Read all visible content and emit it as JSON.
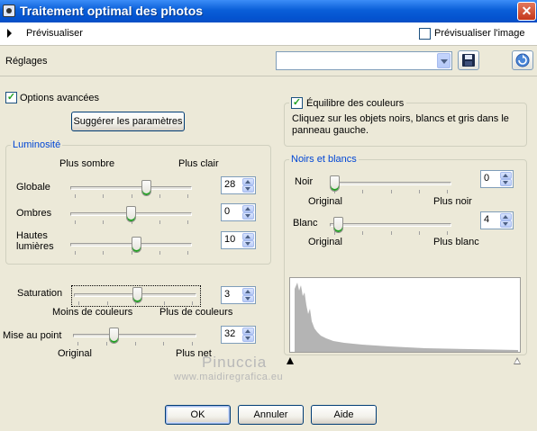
{
  "window": {
    "title": "Traitement optimal des photos",
    "close_glyph": "✕"
  },
  "preview": {
    "label": "Prévisualiser",
    "image_checkbox_label": "Prévisualiser l'image",
    "image_checked": false
  },
  "settings": {
    "label": "Réglages",
    "combo_value": ""
  },
  "advanced": {
    "label": "Options avancées",
    "checked": true,
    "suggest_button": "Suggérer les paramètres"
  },
  "luminosite": {
    "title": "Luminosité",
    "darker": "Plus sombre",
    "lighter": "Plus clair",
    "rows": [
      {
        "label": "Globale",
        "value": "28",
        "level": 0.64
      },
      {
        "label": "Ombres",
        "value": "0",
        "level": 0.5
      },
      {
        "label": "Hautes lumières",
        "value": "10",
        "level": 0.55
      }
    ]
  },
  "saturation": {
    "label": "Saturation",
    "value": "3",
    "level": 0.52,
    "less": "Moins de couleurs",
    "more": "Plus de couleurs"
  },
  "focus": {
    "label": "Mise au point",
    "value": "32",
    "level": 0.32,
    "original": "Original",
    "more": "Plus net"
  },
  "color_balance": {
    "label": "Équilibre des couleurs",
    "checked": true,
    "description": "Cliquez sur les objets noirs, blancs et gris dans le panneau gauche."
  },
  "noirs_blancs": {
    "title": "Noirs et blancs",
    "noir": {
      "label": "Noir",
      "value": "0",
      "level": 0.0,
      "original": "Original",
      "more": "Plus noir"
    },
    "blanc": {
      "label": "Blanc",
      "value": "4",
      "level": 0.03,
      "original": "Original",
      "more": "Plus blanc"
    }
  },
  "buttons": {
    "ok": "OK",
    "cancel": "Annuler",
    "help": "Aide"
  },
  "watermark": {
    "line1": "Pinuccia",
    "line2": "www.maidiregrafica.eu"
  },
  "colors": {
    "titlebar": "#0a5fd8",
    "group_title": "#0046d5",
    "histogram": "#b4b4b4",
    "face": "#ece9d8"
  },
  "icons": {
    "save": "floppy-disk-icon",
    "reset": "reset-icon"
  }
}
